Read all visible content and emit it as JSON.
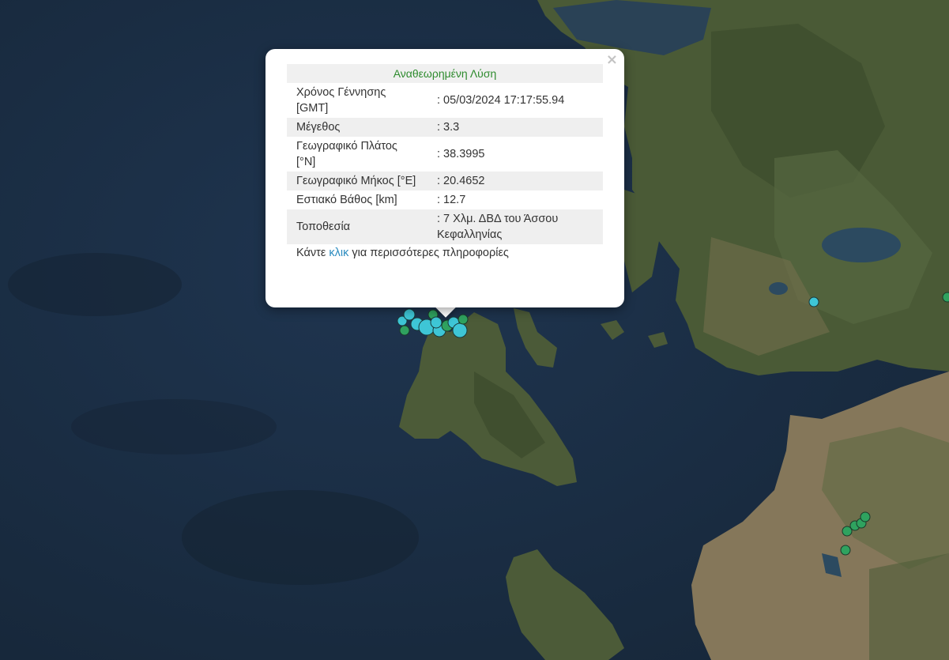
{
  "popup": {
    "close_glyph": "×",
    "title": "Αναθεωρημένη Λύση",
    "rows": [
      {
        "label": "Χρόνος Γέννησης [GMT]",
        "value": ": 05/03/2024 17:17:55.94"
      },
      {
        "label": "Μέγεθος",
        "value": ": 3.3"
      },
      {
        "label": "Γεωγραφικό Πλάτος [°N]",
        "value": ": 38.3995"
      },
      {
        "label": "Γεωγραφικό Μήκος [°E]",
        "value": ": 20.4652"
      },
      {
        "label": "Εστιακό Βάθος [km]",
        "value": ": 12.7"
      },
      {
        "label": "Τοποθεσία",
        "value": ": 7 Χλμ. ΔΒΔ του Άσσου Κεφαλληνίας"
      }
    ],
    "more_prefix": "Κάντε ",
    "more_link": "κλικ",
    "more_suffix": " για περισσότερες πληροφορίες"
  },
  "map": {
    "colors": {
      "sea": "#1c2f45",
      "land": "#4b5a37",
      "land_dark": "#394a2c",
      "plain": "#8a7d5c",
      "lake": "#2c4a60",
      "marker_cyan": "#3ec6d6",
      "marker_green": "#2fa25f"
    }
  }
}
